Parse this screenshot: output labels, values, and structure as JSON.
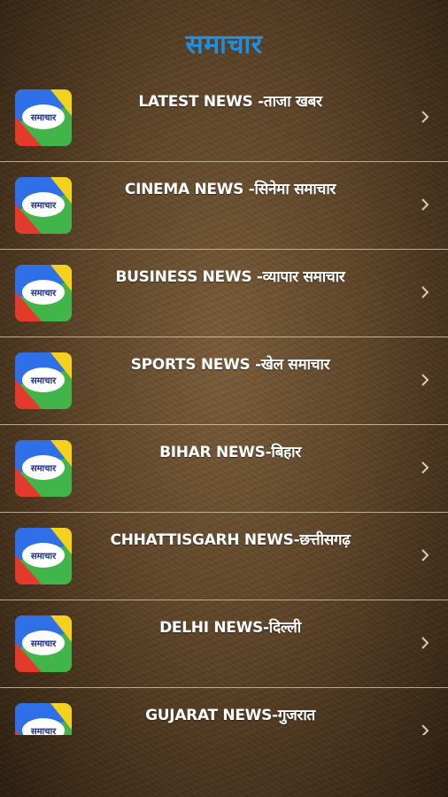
{
  "app": {
    "title": "समाचार"
  },
  "logo": {
    "text": "समाचार"
  },
  "colors": {
    "title": "#1f8fe0",
    "logo_blue": "#2f6fe8",
    "logo_yellow": "#f4d11c",
    "logo_green": "#42b54a",
    "logo_red": "#e43a2c",
    "divider": "#e1d2b9"
  },
  "icons": {
    "chevron": "chevron-right-icon",
    "logo": "samachar-logo-icon"
  },
  "items": [
    {
      "label": "LATEST NEWS -ताजा खबर"
    },
    {
      "label": "CINEMA  NEWS -सिनेमा समाचार"
    },
    {
      "label": "BUSINESS NEWS -व्यापार समाचार"
    },
    {
      "label": "SPORTS NEWS -खेल समाचार"
    },
    {
      "label": "BIHAR NEWS-बिहार"
    },
    {
      "label": "CHHATTISGARH NEWS-छत्तीसगढ़"
    },
    {
      "label": "DELHI NEWS-दिल्ली"
    },
    {
      "label": "GUJARAT NEWS-गुजरात"
    }
  ]
}
